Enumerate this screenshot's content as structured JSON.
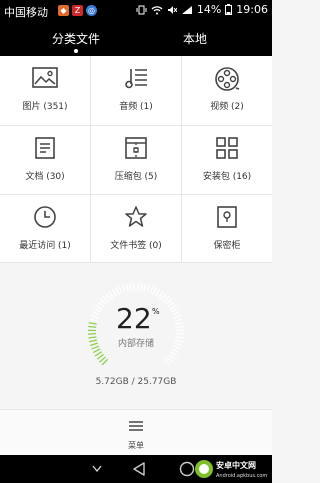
{
  "status_bar": {
    "carrier": "中国移动",
    "battery": "14%",
    "time": "19:06",
    "badge_colors": [
      "#e06a2a",
      "#d02828",
      "#3a7ad8"
    ]
  },
  "tabs": [
    {
      "label": "分类文件",
      "active": true
    },
    {
      "label": "本地",
      "active": false
    }
  ],
  "categories": [
    {
      "label": "图片 (351)",
      "icon": "image-icon"
    },
    {
      "label": "音频 (1)",
      "icon": "music-icon"
    },
    {
      "label": "视频 (2)",
      "icon": "video-reel-icon"
    },
    {
      "label": "文档 (30)",
      "icon": "document-icon"
    },
    {
      "label": "压缩包 (5)",
      "icon": "archive-icon"
    },
    {
      "label": "安装包 (16)",
      "icon": "apps-grid-icon"
    },
    {
      "label": "最近访问 (1)",
      "icon": "clock-icon"
    },
    {
      "label": "文件书签 (0)",
      "icon": "star-icon"
    },
    {
      "label": "保密柜",
      "icon": "safe-icon"
    }
  ],
  "storage": {
    "percent": "22",
    "percent_sign": "%",
    "percent_value": 0.22,
    "label": "内部存储",
    "size_text": "5.72GB / 25.77GB",
    "accent": "#8ccf4d"
  },
  "menu": {
    "label": "菜单"
  },
  "watermark": {
    "line1": "安卓中文网",
    "line2": "Android.apkbus.com"
  }
}
